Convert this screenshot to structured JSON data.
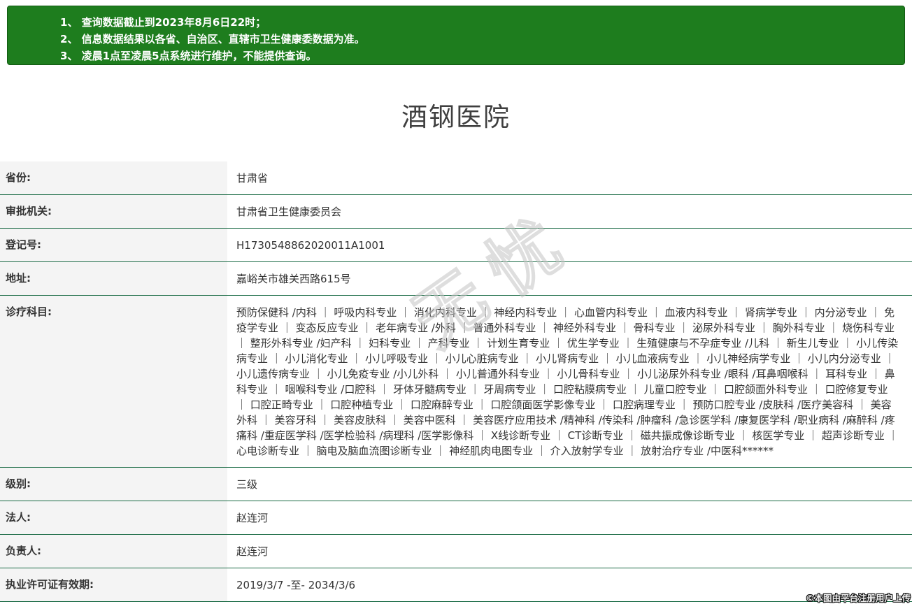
{
  "notice": {
    "lines": [
      "1、 查询数据截止到2023年8月6日22时；",
      "2、 信息数据结果以各省、自治区、直辖市卫生健康委数据为准。",
      "3、 凌晨1点至凌晨5点系统进行维护，不能提供查询。"
    ]
  },
  "page_title": "酒钢医院",
  "info_table": {
    "rows": [
      {
        "label": "省份:",
        "value": "甘肃省"
      },
      {
        "label": "审批机关:",
        "value": "甘肃省卫生健康委员会"
      },
      {
        "label": "登记号:",
        "value": "H1730548862020011A1001"
      },
      {
        "label": "地址:",
        "value": "嘉峪关市雄关西路615号"
      },
      {
        "label": "诊疗科目:",
        "value": "预防保健科 /内科 ｜ 呼吸内科专业 ｜ 消化内科专业 ｜ 神经内科专业 ｜ 心血管内科专业 ｜ 血液内科专业 ｜ 肾病学专业 ｜ 内分泌专业 ｜ 免疫学专业 ｜ 变态反应专业 ｜ 老年病专业 /外科 ｜ 普通外科专业 ｜ 神经外科专业 ｜ 骨科专业 ｜ 泌尿外科专业 ｜ 胸外科专业 ｜ 烧伤科专业 ｜ 整形外科专业 /妇产科 ｜ 妇科专业 ｜ 产科专业 ｜ 计划生育专业 ｜ 优生学专业 ｜ 生殖健康与不孕症专业 /儿科 ｜ 新生儿专业 ｜ 小儿传染病专业 ｜ 小儿消化专业 ｜ 小儿呼吸专业 ｜ 小儿心脏病专业 ｜ 小儿肾病专业 ｜ 小儿血液病专业 ｜ 小儿神经病学专业 ｜ 小儿内分泌专业 ｜ 小儿遗传病专业 ｜ 小儿免疫专业 /小儿外科 ｜ 小儿普通外科专业 ｜ 小儿骨科专业 ｜ 小儿泌尿外科专业 /眼科 /耳鼻咽喉科 ｜ 耳科专业 ｜ 鼻科专业 ｜ 咽喉科专业 /口腔科 ｜ 牙体牙髓病专业 ｜ 牙周病专业 ｜ 口腔粘膜病专业 ｜ 儿童口腔专业 ｜ 口腔颌面外科专业 ｜ 口腔修复专业 ｜ 口腔正畸专业 ｜ 口腔种植专业 ｜ 口腔麻醉专业 ｜ 口腔颌面医学影像专业 ｜ 口腔病理专业 ｜ 预防口腔专业 /皮肤科 /医疗美容科 ｜ 美容外科 ｜ 美容牙科 ｜ 美容皮肤科 ｜ 美容中医科 ｜ 美容医疗应用技术 /精神科 /传染科 /肿瘤科 /急诊医学科 /康复医学科 /职业病科 /麻醉科 /疼痛科 /重症医学科 /医学检验科 /病理科 /医学影像科 ｜ X线诊断专业 ｜ CT诊断专业 ｜ 磁共振成像诊断专业 ｜ 核医学专业 ｜ 超声诊断专业 ｜ 心电诊断专业 ｜ 脑电及脑血流图诊断专业 ｜ 神经肌肉电图专业 ｜ 介入放射学专业 ｜ 放射治疗专业 /中医科******"
      },
      {
        "label": "级别:",
        "value": "三级"
      },
      {
        "label": "法人:",
        "value": "赵连河"
      },
      {
        "label": "负责人:",
        "value": "赵连河"
      },
      {
        "label": "执业许可证有效期:",
        "value": "2019/3/7 -至- 2034/3/6"
      }
    ]
  },
  "watermark_text": "无忧",
  "footer_credit": "©本图由平台注册用户上传",
  "colors": {
    "notice_bg": "#1e7d1e",
    "notice_border": "#135c13",
    "row_divider": "#1a6b45",
    "label_bg": "#f4f4f4",
    "text": "#333333"
  }
}
